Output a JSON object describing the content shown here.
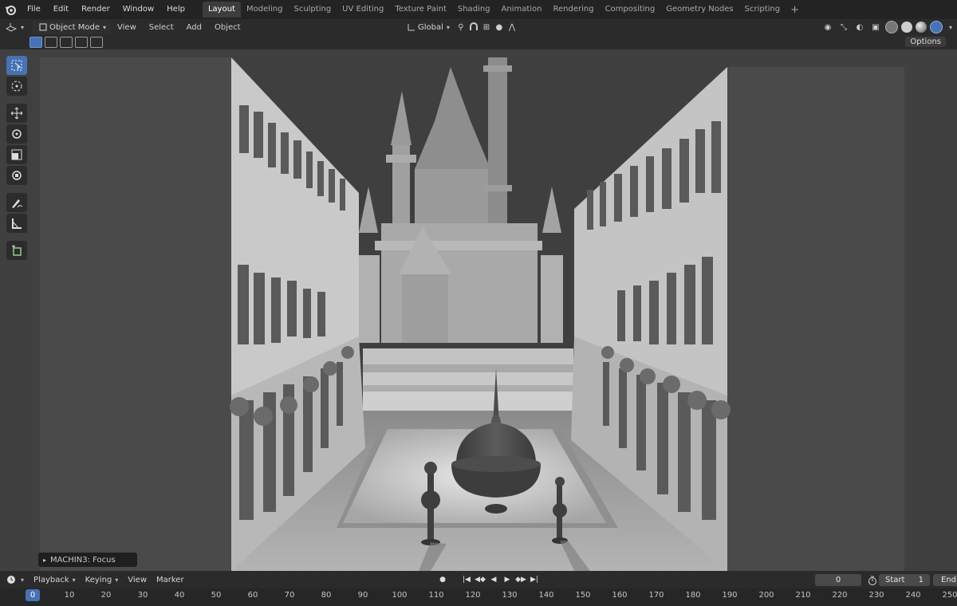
{
  "menu": [
    "File",
    "Edit",
    "Render",
    "Window",
    "Help"
  ],
  "workspaces": [
    "Layout",
    "Modeling",
    "Sculpting",
    "UV Editing",
    "Texture Paint",
    "Shading",
    "Animation",
    "Rendering",
    "Compositing",
    "Geometry Nodes",
    "Scripting"
  ],
  "active_workspace": "Layout",
  "header": {
    "mode": "Object Mode",
    "view": "View",
    "select": "Select",
    "add": "Add",
    "object": "Object",
    "orientation": "Global"
  },
  "options_label": "Options",
  "tools": [
    "select-box",
    "cursor",
    "move",
    "rotate",
    "scale",
    "transform",
    "annotate",
    "measure",
    "add-cube"
  ],
  "operator_panel": "MACHIN3: Focus",
  "timeline": {
    "playback": "Playback",
    "keying": "Keying",
    "view": "View",
    "marker": "Marker",
    "current_frame": "0",
    "start_label": "Start",
    "start_value": "1",
    "end_label": "End",
    "ruler_ticks": [
      "0",
      "10",
      "20",
      "30",
      "40",
      "50",
      "60",
      "70",
      "80",
      "90",
      "100",
      "110",
      "120",
      "130",
      "140",
      "150",
      "160",
      "170",
      "180",
      "190",
      "200",
      "210",
      "220",
      "230",
      "240",
      "250"
    ]
  },
  "colors": {
    "accent": "#4772b3",
    "topbar": "#232323",
    "header": "#2b2b2b",
    "viewport": "#404040"
  }
}
